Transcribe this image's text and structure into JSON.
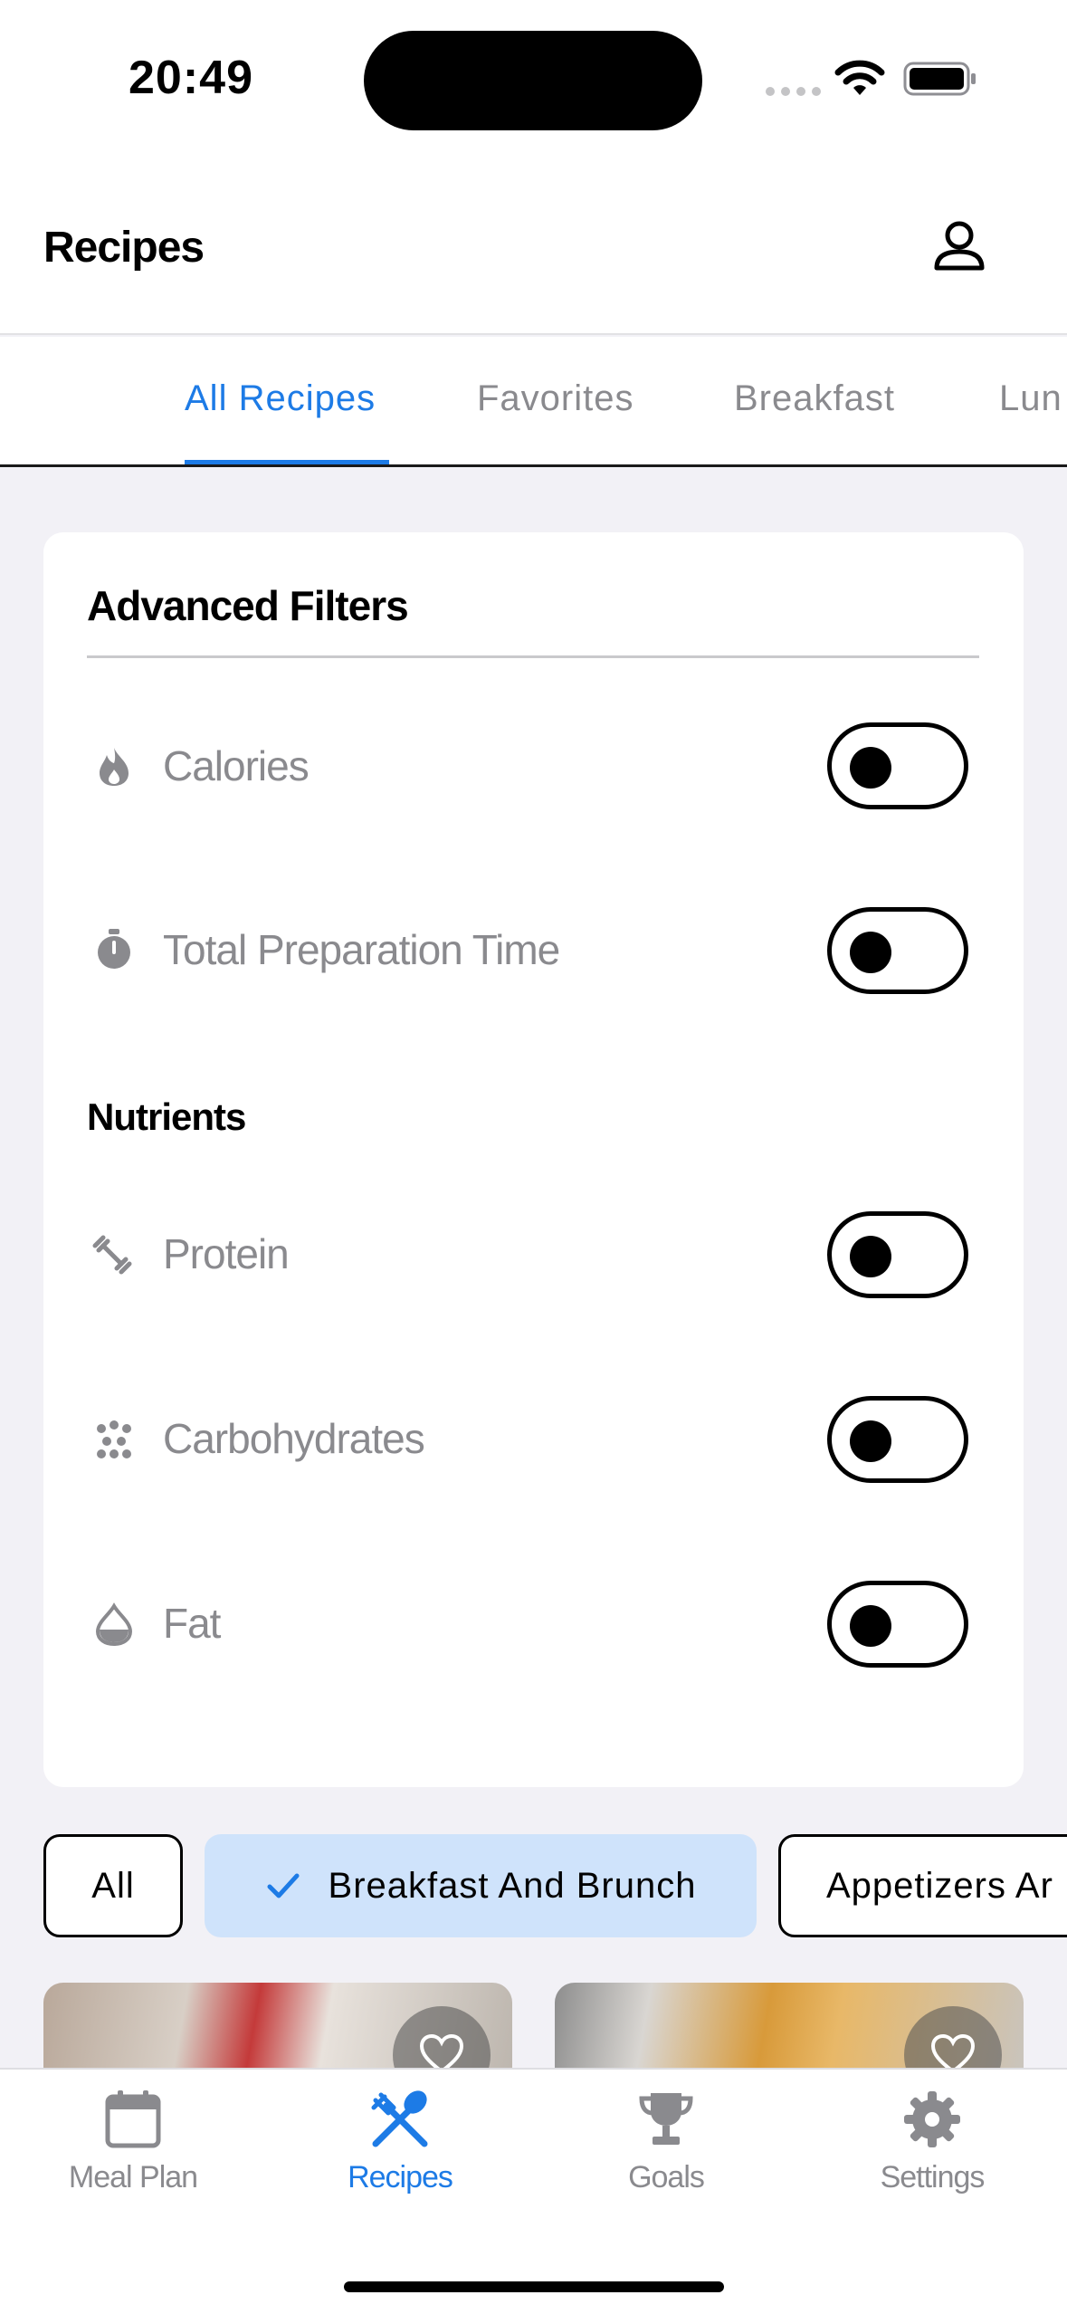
{
  "status_bar": {
    "time": "20:49"
  },
  "header": {
    "title": "Recipes",
    "profile_icon": "person-icon"
  },
  "tabs": [
    {
      "label": "All Recipes",
      "active": true
    },
    {
      "label": "Favorites",
      "active": false
    },
    {
      "label": "Breakfast",
      "active": false
    },
    {
      "label": "Lun",
      "active": false
    }
  ],
  "filters": {
    "title": "Advanced Filters",
    "rows": [
      {
        "label": "Calories",
        "icon": "flame-icon",
        "on": false
      },
      {
        "label": "Total Preparation Time",
        "icon": "stopwatch-icon",
        "on": false
      }
    ],
    "nutrients_title": "Nutrients",
    "nutrients": [
      {
        "label": "Protein",
        "icon": "dumbbell-icon",
        "on": false
      },
      {
        "label": "Carbohydrates",
        "icon": "dots-icon",
        "on": false
      },
      {
        "label": "Fat",
        "icon": "drop-icon",
        "on": false
      }
    ]
  },
  "chips": [
    {
      "label": "All",
      "selected": false
    },
    {
      "label": "Breakfast And Brunch",
      "selected": true
    },
    {
      "label": "Appetizers Ar",
      "selected": false
    }
  ],
  "bottom_nav": [
    {
      "label": "Meal Plan",
      "icon": "calendar-icon",
      "active": false
    },
    {
      "label": "Recipes",
      "icon": "fork-knife-icon",
      "active": true
    },
    {
      "label": "Goals",
      "icon": "trophy-icon",
      "active": false
    },
    {
      "label": "Settings",
      "icon": "gear-icon",
      "active": false
    }
  ],
  "colors": {
    "accent": "#1d7be6",
    "chip_selected": "#cfe3fb",
    "muted_text": "#8a8a8e",
    "background": "#f2f1f6"
  }
}
